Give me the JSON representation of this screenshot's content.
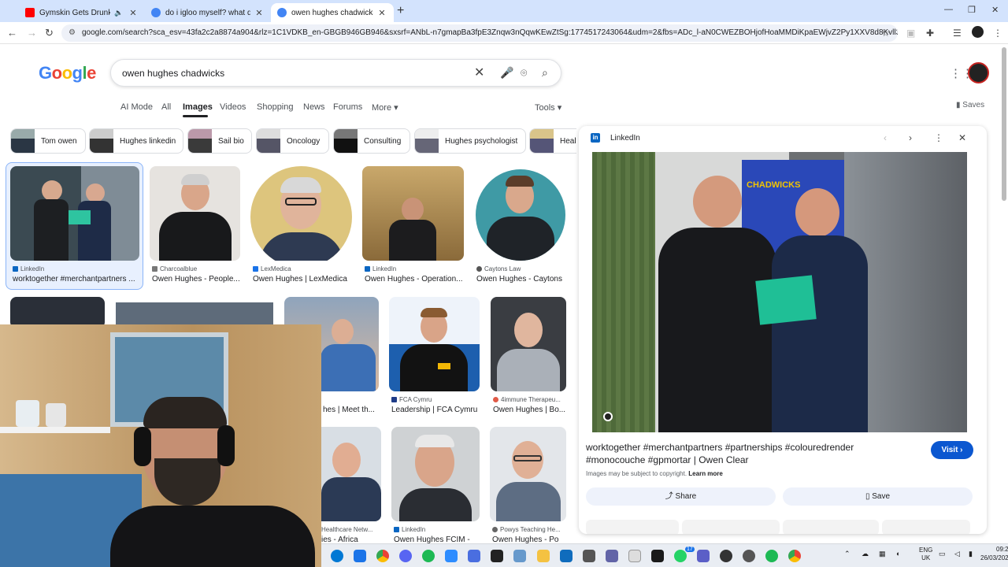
{
  "browser": {
    "tabs": [
      {
        "title": "Gymskin Gets Drunk on a Fl",
        "favicon_color": "#ff0000",
        "muted": true
      },
      {
        "title": "do i igloo myself? what does th",
        "favicon_color": "#4285f4"
      },
      {
        "title": "owen hughes chadwicks - Goo",
        "favicon_color": "#4285f4",
        "active": true
      }
    ],
    "url": "google.com/search?sca_esv=43fa2c2a8874a904&rlz=1C1VDKB_en-GBGB946GB946&sxsrf=ANbL-n7gmapBa3fpE3Znqw3nQqwKEwZtSg:1774517243064&udm=2&fbs=ADc_l-aN0CWEZBOHjofHoaMMDiKpaEWjvZ2Py1XXV8d8Kvll3p-ML-906rRL..."
  },
  "google": {
    "logo_letters": [
      "G",
      "o",
      "o",
      "g",
      "l",
      "e"
    ],
    "query": "owen hughes chadwicks",
    "tabs": [
      {
        "label": "AI Mode"
      },
      {
        "label": "All"
      },
      {
        "label": "Images",
        "active": true
      },
      {
        "label": "Videos"
      },
      {
        "label": "Shopping"
      },
      {
        "label": "News"
      },
      {
        "label": "Forums"
      },
      {
        "label": "More ▾"
      }
    ],
    "tools_label": "Tools ▾",
    "saves_label": "Saves"
  },
  "chips": [
    {
      "label": "Tom owen"
    },
    {
      "label": "Hughes linkedin"
    },
    {
      "label": "Sail bio"
    },
    {
      "label": "Oncology"
    },
    {
      "label": "Consulting"
    },
    {
      "label": "Hughes psychologist"
    },
    {
      "label": "Healt"
    }
  ],
  "results": [
    {
      "source": "LinkedIn",
      "caption": "worktogether #merchantpartners ...",
      "source_color": "#0a66c2"
    },
    {
      "source": "Charcoalblue",
      "caption": "Owen Hughes - People...",
      "source_color": "#777777"
    },
    {
      "source": "LexMedica",
      "caption": "Owen Hughes | LexMedica",
      "source_color": "#1a73e8"
    },
    {
      "source": "LinkedIn",
      "caption": "Owen Hughes - Operation...",
      "source_color": "#0a66c2"
    },
    {
      "source": "Caytons Law",
      "caption": "Owen Hughes - Caytons",
      "source_color": "#555555"
    },
    {
      "source": "",
      "caption": "hes | Meet th...",
      "source_color": "#777777"
    },
    {
      "source": "FCA Cymru",
      "caption": "Leadership | FCA Cymru",
      "source_color": "#1f3c88"
    },
    {
      "source": "4immune Therapeu...",
      "caption": "Owen Hughes | Bo...",
      "source_color": "#e05a47"
    },
    {
      "source": "Healthcare Netw...",
      "caption": "ies - Africa",
      "source_color": "#777777"
    },
    {
      "source": "LinkedIn",
      "caption": "Owen Hughes FCIM -",
      "source_color": "#0a66c2"
    },
    {
      "source": "Powys Teaching He...",
      "caption": "Owen Hughes - Po",
      "source_color": "#666666"
    }
  ],
  "panel": {
    "source": "LinkedIn",
    "title": "worktogether #merchantpartners #partnerships #colouredrender #monocouche #gpmortar | Owen Clear",
    "visit_label": "Visit ›",
    "copyright_text": "Images may be subject to copyright.",
    "learn_more": "Learn more",
    "share_label": "Share",
    "save_label": "Save",
    "sign_text": "CHADWICKS"
  },
  "taskbar": {
    "teams_badge": "17",
    "lang_top": "ENG",
    "lang_bottom": "UK",
    "time": "09:27",
    "date": "26/03/2026"
  },
  "colors": {
    "accent": "#0b57d0",
    "tabstrip": "#d3e3fd",
    "linkedin": "#0a66c2"
  }
}
